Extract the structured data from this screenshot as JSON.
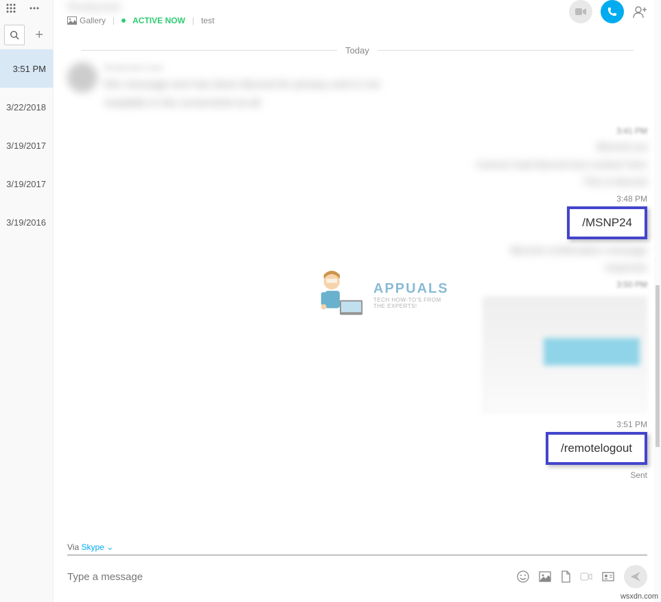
{
  "sidebar": {
    "dates": [
      {
        "label": "3:51 PM",
        "selected": true
      },
      {
        "label": "3/22/2018",
        "selected": false
      },
      {
        "label": "3/19/2017",
        "selected": false
      },
      {
        "label": "3/19/2017",
        "selected": false
      },
      {
        "label": "3/19/2016",
        "selected": false
      }
    ]
  },
  "header": {
    "contact_name": "Redacted",
    "gallery_label": "Gallery",
    "active_label": "ACTIVE NOW",
    "extra_label": "test"
  },
  "chat": {
    "divider": "Today",
    "incoming": {
      "name": "Redacted User",
      "body": "this message text has been blurred for privacy and is not readable in the screenshot at all"
    },
    "outgoing_blur": {
      "ts": "3:41 PM",
      "l1": "Blurred out",
      "l2": "Cannot read blurred text content here",
      "l3": "This is blurred"
    },
    "cmd1": {
      "ts": "3:48 PM",
      "text": "/MSNP24"
    },
    "reply_blur": "Blurred confirmation message response",
    "preview_ts": "3:50 PM",
    "cmd2": {
      "ts": "3:51 PM",
      "text": "/remotelogout",
      "status": "Sent"
    }
  },
  "watermark": {
    "title": "APPUALS",
    "sub1": "TECH HOW-TO'S FROM",
    "sub2": "THE EXPERTS!"
  },
  "footer": {
    "via_label": "Via",
    "via_service": "Skype",
    "placeholder": "Type a message"
  },
  "attribution": "wsxdn.com"
}
